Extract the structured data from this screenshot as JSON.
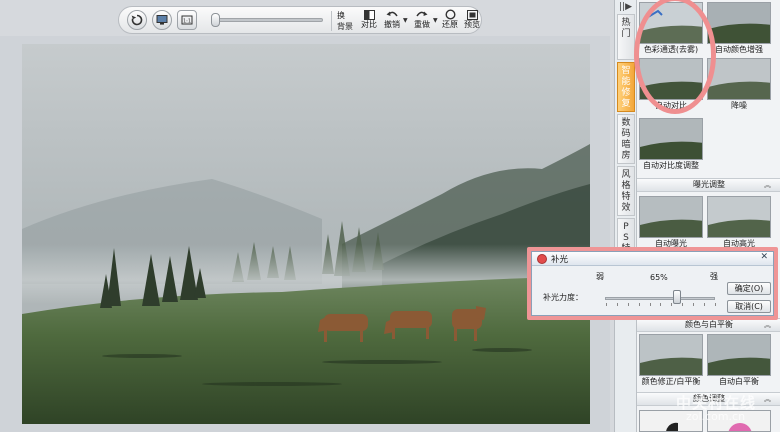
{
  "toolbar": {
    "tools": [
      {
        "id": "swap-bg",
        "label": "换\n背景"
      },
      {
        "id": "compare",
        "label": "对比"
      },
      {
        "id": "undo",
        "label": "撤销"
      },
      {
        "id": "redo",
        "label": "重做"
      },
      {
        "id": "restore",
        "label": "还原"
      },
      {
        "id": "preview",
        "label": "预览"
      }
    ]
  },
  "side_tabs": {
    "collapse_glyph": "||▶",
    "tabs": [
      {
        "label": "热\n门"
      },
      {
        "label": "智\n能\n修\n复",
        "active": true
      },
      {
        "label": "数\n码\n暗\n房"
      },
      {
        "label": "风\n格\n特\n效"
      },
      {
        "label": "P\nS\n特\n效"
      }
    ]
  },
  "panel": {
    "thumbs": [
      {
        "caption": "色彩通透(去雾)"
      },
      {
        "caption": "自动颜色增强"
      },
      {
        "caption": "自动对比"
      },
      {
        "caption": "降噪"
      },
      {
        "caption": "自动对比度调整"
      },
      {
        "caption": "自动曝光"
      },
      {
        "caption": "自动高光"
      },
      {
        "caption": "颜色修正/白平衡"
      },
      {
        "caption": "自动白平衡"
      }
    ],
    "sections": {
      "exposure": "曝光调整",
      "color": "颜色与白平衡",
      "color_adjust": "颜色调整"
    }
  },
  "dialog": {
    "title": "补光",
    "close_glyph": "✕",
    "label": "补光力度：",
    "weak": "弱",
    "strong": "强",
    "value_text": "65%",
    "value": 65,
    "ok": "确定(O)",
    "cancel": "取消(C)"
  },
  "watermark": {
    "text": "中关村在线",
    "sub": "zol.com.cn"
  },
  "colors": {
    "highlight": "#ef8f90",
    "active_tab": "#f3a73a"
  }
}
